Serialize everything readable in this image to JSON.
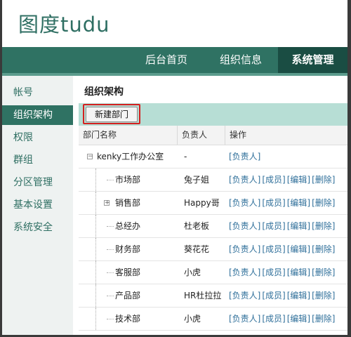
{
  "header": {
    "logo_cn": "图度",
    "logo_en": "tudu"
  },
  "topnav": {
    "tabs": [
      {
        "label": "后台首页"
      },
      {
        "label": "组织信息"
      },
      {
        "label": "系统管理"
      }
    ]
  },
  "sidebar": {
    "items": [
      {
        "label": "帐号"
      },
      {
        "label": "组织架构"
      },
      {
        "label": "权限"
      },
      {
        "label": "群组"
      },
      {
        "label": "分区管理"
      },
      {
        "label": "基本设置"
      },
      {
        "label": "系统安全"
      }
    ]
  },
  "main": {
    "title": "组织架构",
    "new_button": "新建部门",
    "columns": [
      "部门名称",
      "负责人",
      "操作"
    ],
    "rows": [
      {
        "name": "kenky工作办公室",
        "lead": "-",
        "ops": [
          "[负责人]"
        ]
      },
      {
        "name": "市场部",
        "lead": "兔子姐",
        "ops": [
          "[负责人]",
          "[成员]",
          "[编辑]",
          "[删除]"
        ]
      },
      {
        "name": "销售部",
        "lead": "Happy哥",
        "ops": [
          "[负责人]",
          "[成员]",
          "[编辑]",
          "[删除]"
        ]
      },
      {
        "name": "总经办",
        "lead": "杜老板",
        "ops": [
          "[负责人]",
          "[成员]",
          "[编辑]",
          "[删除]"
        ]
      },
      {
        "name": "财务部",
        "lead": "葵花花",
        "ops": [
          "[负责人]",
          "[成员]",
          "[编辑]",
          "[删除]"
        ]
      },
      {
        "name": "客服部",
        "lead": "小虎",
        "ops": [
          "[负责人]",
          "[成员]",
          "[编辑]",
          "[删除]"
        ]
      },
      {
        "name": "产品部",
        "lead": "HR杜拉拉",
        "ops": [
          "[负责人]",
          "[成员]",
          "[编辑]",
          "[删除]"
        ]
      },
      {
        "name": "技术部",
        "lead": "小虎",
        "ops": [
          "[负责人]",
          "[成员]",
          "[编辑]",
          "[删除]"
        ]
      }
    ],
    "toggles": {
      "collapse": "−",
      "expand": "+"
    }
  },
  "colors": {
    "brand": "#2f7263",
    "nav_active": "#1a4d43",
    "toolbar": "#b7ded5",
    "highlight": "#d42020",
    "link": "#2f6f9a"
  }
}
